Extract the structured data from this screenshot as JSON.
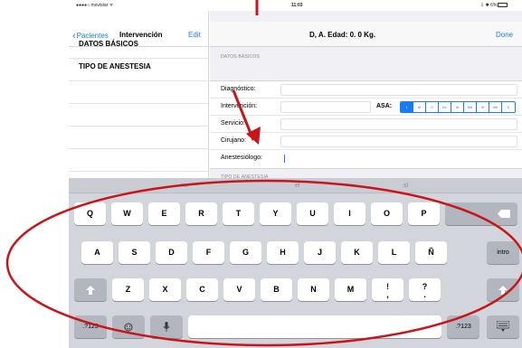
{
  "status_bar": {
    "carrier": "●●●●○ movistar ᯤ",
    "time": "11:03",
    "battery": "⇩ ✱ 6%"
  },
  "left_nav": {
    "back_label": "Pacientes",
    "title": "Intervención",
    "edit_label": "Edit"
  },
  "left_list": [
    {
      "label": "DATOS BÁSICOS"
    },
    {
      "label": "TIPO DE ANESTESIA"
    }
  ],
  "right_nav": {
    "title": "D, A. Edad: 0. 0 Kg.",
    "done_label": "Done"
  },
  "sections": {
    "basic_data_header": "DATOS BÁSICOS",
    "anesthesia_header": "TIPO DE ANESTESIA"
  },
  "form": {
    "diagnostico_label": "Diagnóstico:",
    "intervencion_label": "Intervención:",
    "servicio_label": "Servicio:",
    "cirujano_label": "Cirujano:",
    "anestesiologo_label": "Anestesiólogo:",
    "asa_label": "ASA:",
    "asa_options": [
      "I",
      "Ie",
      "II",
      "IIe",
      "III",
      "IIIe",
      "IV",
      "IVe",
      "V"
    ],
    "asa_selected_index": 0
  },
  "keyboard": {
    "predictions": [
      "no",
      "el",
      "sí"
    ],
    "row1": [
      "Q",
      "W",
      "E",
      "R",
      "T",
      "Y",
      "U",
      "I",
      "O",
      "P"
    ],
    "row2": [
      "A",
      "S",
      "D",
      "F",
      "G",
      "H",
      "J",
      "K",
      "L",
      "Ñ"
    ],
    "row3": [
      "Z",
      "X",
      "C",
      "V",
      "B",
      "N",
      "M"
    ],
    "punct1_top": "!",
    "punct1_bottom": ",",
    "punct2_top": "?",
    "punct2_bottom": ".",
    "return_label": "intro",
    "numbers_label": ".?123"
  },
  "colors": {
    "accent": "#1a7cf5",
    "annotation_red": "#c8151b"
  }
}
